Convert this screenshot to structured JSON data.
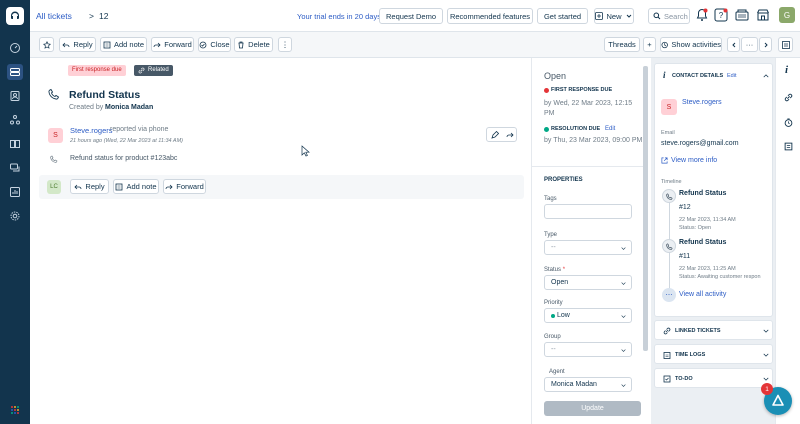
{
  "header": {
    "breadcrumb_all": "All tickets",
    "breadcrumb_sep": ">",
    "ticket_number": "12",
    "trial_text": "Your trial ends in 20 days",
    "request_demo": "Request Demo",
    "recommended_features": "Recommended features",
    "get_started": "Get started",
    "new_label": "New",
    "search_placeholder": "Search",
    "avatar_initial": "G"
  },
  "toolbar": {
    "reply": "Reply",
    "add_note": "Add note",
    "forward": "Forward",
    "close": "Close",
    "delete": "Delete",
    "more": "⋮",
    "threads": "Threads",
    "plus": "+",
    "show_activities": "Show activities",
    "more2": "···"
  },
  "ticket": {
    "badge_first_response": "First response due",
    "badge_related": "Related",
    "title": "Refund Status",
    "created_by_label": "Created by",
    "created_by": "Monica Madan",
    "author_initial": "S",
    "author": "Steve.rogers",
    "reported_via": "reported via phone",
    "time": "21 hours ago (Wed, 22 Mar 2023 at 11:34 AM)",
    "body": "Refund status for product #123abc",
    "reply_avatar": "LC",
    "reply": "Reply",
    "add_note": "Add note",
    "forward": "Forward"
  },
  "properties": {
    "status_title": "Open",
    "first_response_label": "FIRST RESPONSE DUE",
    "first_response_due": "by Wed, 22 Mar 2023, 12:15 PM",
    "resolution_label": "RESOLUTION DUE",
    "resolution_edit": "Edit",
    "resolution_due": "by Thu, 23 Mar 2023, 09:00 PM",
    "section": "PROPERTIES",
    "tags_label": "Tags",
    "type_label": "Type",
    "type_value": "--",
    "status_label": "Status",
    "required_mark": "*",
    "status_value": "Open",
    "priority_label": "Priority",
    "priority_value": "Low",
    "group_label": "Group",
    "group_value": "--",
    "agent_label": "Agent",
    "agent_value": "Monica Madan",
    "update_button": "Update"
  },
  "contact": {
    "header": "CONTACT DETAILS",
    "edit": "Edit",
    "avatar_initial": "S",
    "name": "Steve.rogers",
    "email_label": "Email",
    "email": "steve.rogers@gmail.com",
    "view_more": "View more info",
    "timeline_label": "Timeline",
    "timeline": [
      {
        "title": "Refund Status",
        "number": "#12",
        "date": "22 Mar 2023, 11:34 AM",
        "status": "Status: Open"
      },
      {
        "title": "Refund Status",
        "number": "#11",
        "date": "22 Mar 2023, 11:25 AM",
        "status": "Status: Awaiting customer respon"
      }
    ],
    "view_all": "View all activity",
    "linked_tickets": "LINKED TICKETS",
    "time_logs": "TIME LOGS",
    "todo": "TO-DO",
    "notif_count": "1"
  },
  "colors": {
    "nav_bg": "#12344d",
    "link": "#2c5cc5",
    "due_red": "#e43538",
    "resolution_green": "#00a886",
    "priority_green": "#00a886",
    "update_bg": "#b0bac4",
    "fab_bg": "#1a8fb5",
    "notif_bg": "#e43538"
  }
}
